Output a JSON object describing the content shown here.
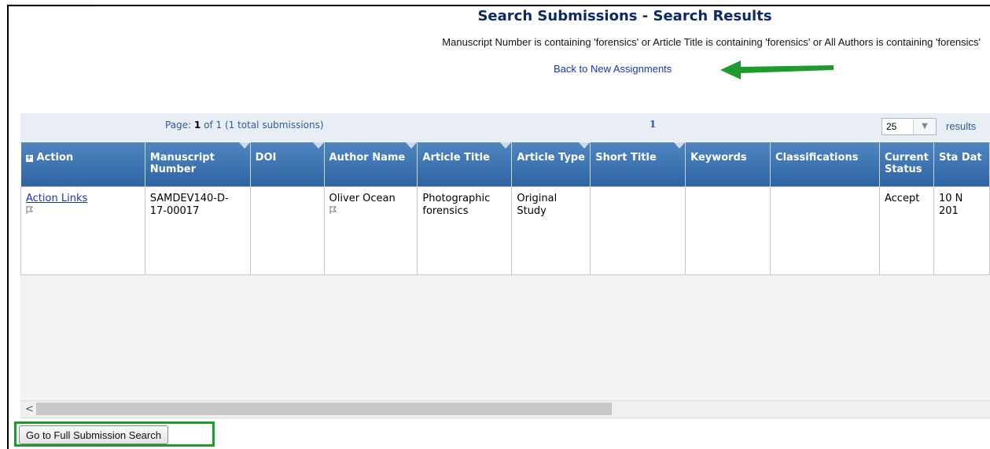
{
  "header": {
    "title": "Search Submissions - Search Results",
    "criteria": "Manuscript Number is containing 'forensics' or Article Title is containing 'forensics' or All Authors is containing 'forensics'",
    "back_link": "Back to New Assignments"
  },
  "pager": {
    "page_label": "Page:",
    "current_page": "1",
    "of_total": "of 1 (1 total submissions)",
    "page_links": "1",
    "per_page": "25",
    "results_label": "results"
  },
  "table": {
    "columns": [
      "Action",
      "Manuscript Number",
      "DOI",
      "Author Name",
      "Article Title",
      "Article Type",
      "Short Title",
      "Keywords",
      "Classifications",
      "Current Status",
      "Sta Dat"
    ],
    "rows": [
      {
        "action": "Action Links",
        "manuscript_number": "SAMDEV140-D-17-00017",
        "doi": "",
        "author_name": "Oliver Ocean",
        "article_title": "Photographic forensics",
        "article_type": "Original Study",
        "short_title": "",
        "keywords": "",
        "classifications": "",
        "current_status": "Accept",
        "status_date": "10 N 201"
      }
    ]
  },
  "footer": {
    "scroll_left": "<",
    "full_search_button": "Go to Full Submission Search"
  },
  "colors": {
    "header_blue": "#2f64a3",
    "title_navy": "#0b2a66",
    "link_blue": "#1533c4",
    "annotation_green": "#1f9a2e"
  },
  "icons": [
    "expand-icon",
    "sort-indicator",
    "flag-icon",
    "green-arrow-icon",
    "scroll-left-arrow"
  ]
}
